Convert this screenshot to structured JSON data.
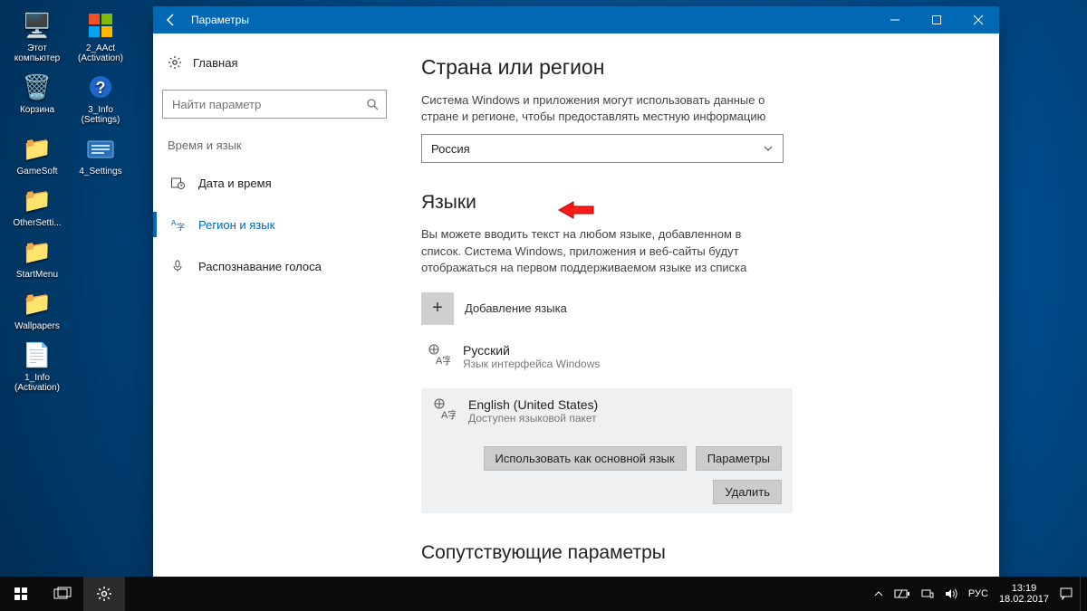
{
  "desktop_icons": {
    "this_pc": "Этот\nкомпьютер",
    "aact": "2_AAct\n(Activation)",
    "recycle": "Корзина",
    "info3": "3_Info\n(Settings)",
    "gamesoft": "GameSoft",
    "settings4": "4_Settings",
    "othersettings": "OtherSetti...",
    "startmenu": "StartMenu",
    "wallpapers": "Wallpapers",
    "info1": "1_Info\n(Activation)"
  },
  "window": {
    "title": "Параметры",
    "home": "Главная",
    "search_placeholder": "Найти параметр",
    "category": "Время и язык",
    "side": {
      "datetime": "Дата и время",
      "region": "Регион и язык",
      "speech": "Распознавание голоса"
    }
  },
  "content": {
    "h_region": "Страна или регион",
    "region_desc": "Система Windows и приложения могут использовать данные о стране и регионе, чтобы предоставлять местную информацию",
    "region_value": "Россия",
    "h_lang": "Языки",
    "lang_desc": "Вы можете вводить текст на любом языке, добавленном в список. Система Windows, приложения и веб-сайты будут отображаться на первом поддерживаемом языке из списка",
    "add_lang": "Добавление языка",
    "lang1_name": "Русский",
    "lang1_sub": "Язык интерфейса Windows",
    "lang2_name": "English (United States)",
    "lang2_sub": "Доступен языковой пакет",
    "btn_default": "Использовать как основной язык",
    "btn_options": "Параметры",
    "btn_remove": "Удалить",
    "h_related": "Сопутствующие параметры"
  },
  "tray": {
    "lang": "РУС",
    "time": "13:19",
    "date": "18.02.2017"
  }
}
